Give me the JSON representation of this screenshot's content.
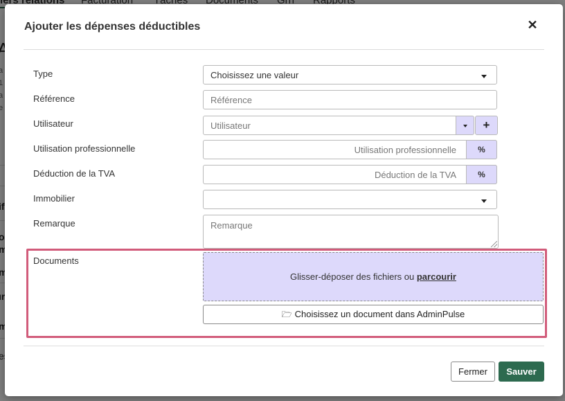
{
  "background": {
    "tabs": [
      "iers relations",
      "Facturation",
      "Tâches",
      "Documents",
      "Grh",
      "Rapports"
    ],
    "left_fragments": [
      "A",
      "a",
      "1",
      "a",
      "e",
      "if",
      "o",
      "m",
      "m",
      "ır",
      "m",
      "es"
    ]
  },
  "modal": {
    "title": "Ajouter les dépenses déductibles",
    "close_icon": "close-icon",
    "fields": {
      "type": {
        "label": "Type",
        "value": "Choisissez une valeur"
      },
      "reference": {
        "label": "Référence",
        "placeholder": "Référence"
      },
      "user": {
        "label": "Utilisateur",
        "placeholder": "Utilisateur",
        "add_label": "+"
      },
      "professional_use": {
        "label": "Utilisation professionnelle",
        "placeholder": "Utilisation professionnelle",
        "unit": "%"
      },
      "vat_deduction": {
        "label": "Déduction de la TVA",
        "placeholder": "Déduction de la TVA",
        "unit": "%"
      },
      "real_estate": {
        "label": "Immobilier",
        "value": ""
      },
      "remark": {
        "label": "Remarque",
        "placeholder": "Remarque"
      },
      "documents": {
        "label": "Documents",
        "dropzone_text": "Glisser-déposer des fichiers ou ",
        "browse_text": "parcourir",
        "choose_button": "Choisissez un document dans AdminPulse",
        "folder_icon": "folder-open-icon"
      }
    },
    "footer": {
      "close_button": "Fermer",
      "save_button": "Sauver"
    }
  },
  "colors": {
    "accent_lavender": "#ddd9fb",
    "primary_green": "#2d6a4f",
    "highlight_pink": "#d15b7a"
  }
}
